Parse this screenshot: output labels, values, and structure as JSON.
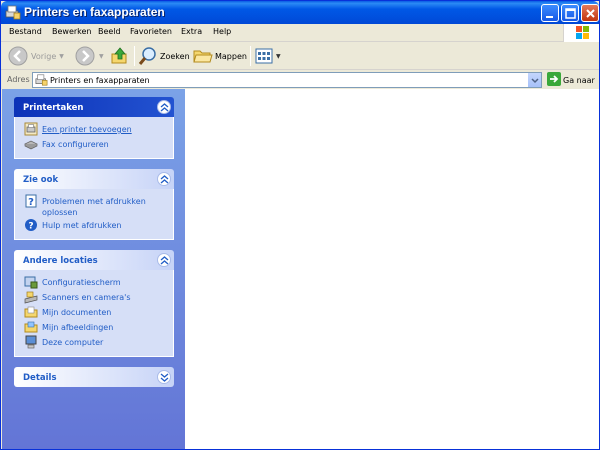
{
  "window": {
    "title": "Printers en faxapparaten"
  },
  "menu": [
    "Bestand",
    "Bewerken",
    "Beeld",
    "Favorieten",
    "Extra",
    "Help"
  ],
  "toolbar": {
    "back_label": "Vorige",
    "search_label": "Zoeken",
    "folders_label": "Mappen"
  },
  "address": {
    "label": "Adres",
    "value": "Printers en faxapparaten",
    "go_label": "Ga naar"
  },
  "panels": {
    "printer_tasks": {
      "title": "Printertaken",
      "items": [
        "Een printer toevoegen",
        "Fax configureren"
      ]
    },
    "see_also": {
      "title": "Zie ook",
      "items": [
        "Problemen met afdrukken oplossen",
        "Hulp met afdrukken"
      ]
    },
    "other_places": {
      "title": "Andere locaties",
      "items": [
        "Configuratiescherm",
        "Scanners en camera's",
        "Mijn documenten",
        "Mijn afbeeldingen",
        "Deze computer"
      ]
    },
    "details": {
      "title": "Details"
    }
  },
  "colors": {
    "titlebar": "#0058e6",
    "sidepane": "#7ba2e7",
    "link": "#215dc6",
    "panel_body": "#d6dff7"
  }
}
